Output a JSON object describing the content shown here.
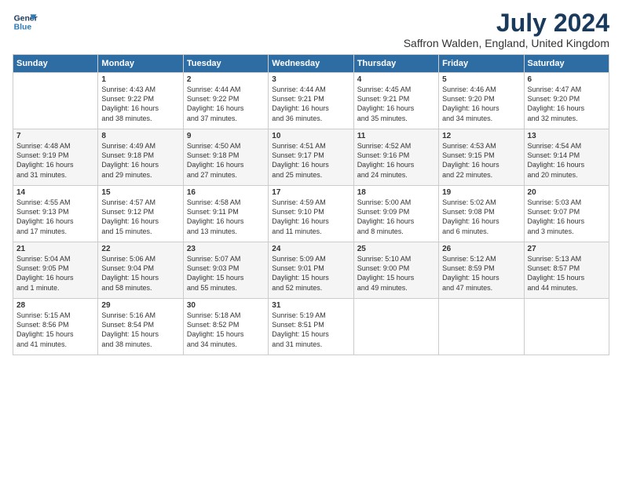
{
  "header": {
    "logo_line1": "General",
    "logo_line2": "Blue",
    "title": "July 2024",
    "subtitle": "Saffron Walden, England, United Kingdom"
  },
  "days_of_week": [
    "Sunday",
    "Monday",
    "Tuesday",
    "Wednesday",
    "Thursday",
    "Friday",
    "Saturday"
  ],
  "weeks": [
    [
      {
        "day": "",
        "info": ""
      },
      {
        "day": "1",
        "info": "Sunrise: 4:43 AM\nSunset: 9:22 PM\nDaylight: 16 hours\nand 38 minutes."
      },
      {
        "day": "2",
        "info": "Sunrise: 4:44 AM\nSunset: 9:22 PM\nDaylight: 16 hours\nand 37 minutes."
      },
      {
        "day": "3",
        "info": "Sunrise: 4:44 AM\nSunset: 9:21 PM\nDaylight: 16 hours\nand 36 minutes."
      },
      {
        "day": "4",
        "info": "Sunrise: 4:45 AM\nSunset: 9:21 PM\nDaylight: 16 hours\nand 35 minutes."
      },
      {
        "day": "5",
        "info": "Sunrise: 4:46 AM\nSunset: 9:20 PM\nDaylight: 16 hours\nand 34 minutes."
      },
      {
        "day": "6",
        "info": "Sunrise: 4:47 AM\nSunset: 9:20 PM\nDaylight: 16 hours\nand 32 minutes."
      }
    ],
    [
      {
        "day": "7",
        "info": "Sunrise: 4:48 AM\nSunset: 9:19 PM\nDaylight: 16 hours\nand 31 minutes."
      },
      {
        "day": "8",
        "info": "Sunrise: 4:49 AM\nSunset: 9:18 PM\nDaylight: 16 hours\nand 29 minutes."
      },
      {
        "day": "9",
        "info": "Sunrise: 4:50 AM\nSunset: 9:18 PM\nDaylight: 16 hours\nand 27 minutes."
      },
      {
        "day": "10",
        "info": "Sunrise: 4:51 AM\nSunset: 9:17 PM\nDaylight: 16 hours\nand 25 minutes."
      },
      {
        "day": "11",
        "info": "Sunrise: 4:52 AM\nSunset: 9:16 PM\nDaylight: 16 hours\nand 24 minutes."
      },
      {
        "day": "12",
        "info": "Sunrise: 4:53 AM\nSunset: 9:15 PM\nDaylight: 16 hours\nand 22 minutes."
      },
      {
        "day": "13",
        "info": "Sunrise: 4:54 AM\nSunset: 9:14 PM\nDaylight: 16 hours\nand 20 minutes."
      }
    ],
    [
      {
        "day": "14",
        "info": "Sunrise: 4:55 AM\nSunset: 9:13 PM\nDaylight: 16 hours\nand 17 minutes."
      },
      {
        "day": "15",
        "info": "Sunrise: 4:57 AM\nSunset: 9:12 PM\nDaylight: 16 hours\nand 15 minutes."
      },
      {
        "day": "16",
        "info": "Sunrise: 4:58 AM\nSunset: 9:11 PM\nDaylight: 16 hours\nand 13 minutes."
      },
      {
        "day": "17",
        "info": "Sunrise: 4:59 AM\nSunset: 9:10 PM\nDaylight: 16 hours\nand 11 minutes."
      },
      {
        "day": "18",
        "info": "Sunrise: 5:00 AM\nSunset: 9:09 PM\nDaylight: 16 hours\nand 8 minutes."
      },
      {
        "day": "19",
        "info": "Sunrise: 5:02 AM\nSunset: 9:08 PM\nDaylight: 16 hours\nand 6 minutes."
      },
      {
        "day": "20",
        "info": "Sunrise: 5:03 AM\nSunset: 9:07 PM\nDaylight: 16 hours\nand 3 minutes."
      }
    ],
    [
      {
        "day": "21",
        "info": "Sunrise: 5:04 AM\nSunset: 9:05 PM\nDaylight: 16 hours\nand 1 minute."
      },
      {
        "day": "22",
        "info": "Sunrise: 5:06 AM\nSunset: 9:04 PM\nDaylight: 15 hours\nand 58 minutes."
      },
      {
        "day": "23",
        "info": "Sunrise: 5:07 AM\nSunset: 9:03 PM\nDaylight: 15 hours\nand 55 minutes."
      },
      {
        "day": "24",
        "info": "Sunrise: 5:09 AM\nSunset: 9:01 PM\nDaylight: 15 hours\nand 52 minutes."
      },
      {
        "day": "25",
        "info": "Sunrise: 5:10 AM\nSunset: 9:00 PM\nDaylight: 15 hours\nand 49 minutes."
      },
      {
        "day": "26",
        "info": "Sunrise: 5:12 AM\nSunset: 8:59 PM\nDaylight: 15 hours\nand 47 minutes."
      },
      {
        "day": "27",
        "info": "Sunrise: 5:13 AM\nSunset: 8:57 PM\nDaylight: 15 hours\nand 44 minutes."
      }
    ],
    [
      {
        "day": "28",
        "info": "Sunrise: 5:15 AM\nSunset: 8:56 PM\nDaylight: 15 hours\nand 41 minutes."
      },
      {
        "day": "29",
        "info": "Sunrise: 5:16 AM\nSunset: 8:54 PM\nDaylight: 15 hours\nand 38 minutes."
      },
      {
        "day": "30",
        "info": "Sunrise: 5:18 AM\nSunset: 8:52 PM\nDaylight: 15 hours\nand 34 minutes."
      },
      {
        "day": "31",
        "info": "Sunrise: 5:19 AM\nSunset: 8:51 PM\nDaylight: 15 hours\nand 31 minutes."
      },
      {
        "day": "",
        "info": ""
      },
      {
        "day": "",
        "info": ""
      },
      {
        "day": "",
        "info": ""
      }
    ]
  ]
}
